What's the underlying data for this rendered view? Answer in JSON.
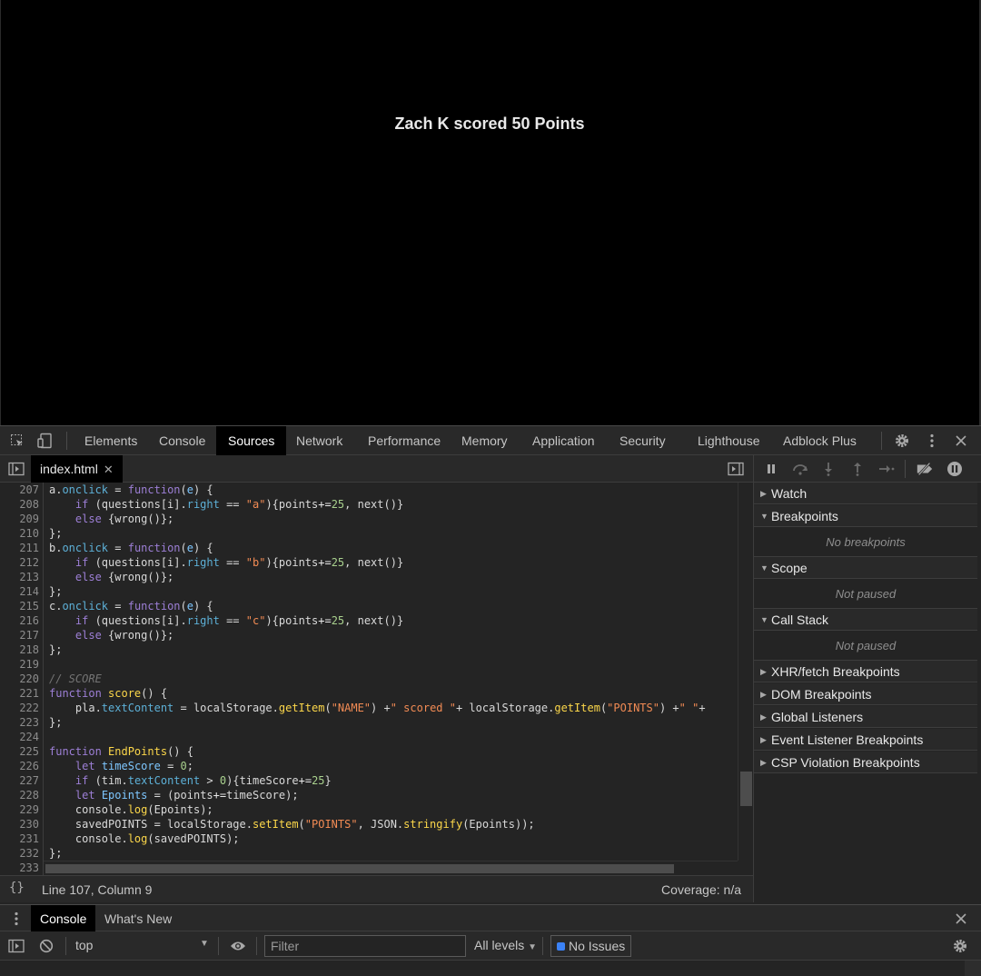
{
  "page": {
    "score_text": "Zach K scored 50 Points"
  },
  "devtools": {
    "tabs": [
      "Elements",
      "Console",
      "Sources",
      "Network",
      "Performance",
      "Memory",
      "Application",
      "Security",
      "Lighthouse",
      "Adblock Plus"
    ],
    "active_tab": "Sources",
    "toolbar_icons": [
      "inspect-icon",
      "device-toggle-icon",
      "settings-icon",
      "more-icon",
      "close-icon"
    ]
  },
  "sources": {
    "file_tab": "index.html",
    "code_lines": [
      {
        "n": "207",
        "segments": [
          [
            "",
            "a."
          ],
          [
            "prop",
            "onclick"
          ],
          [
            "",
            " = "
          ],
          [
            "kw",
            "function"
          ],
          [
            "",
            "("
          ],
          [
            "var",
            "e"
          ],
          [
            "",
            ") {"
          ]
        ]
      },
      {
        "n": "208",
        "segments": [
          [
            "",
            "    "
          ],
          [
            "kw",
            "if"
          ],
          [
            "",
            " (questions[i]."
          ],
          [
            "prop",
            "right"
          ],
          [
            "",
            " == "
          ],
          [
            "str",
            "\"a\""
          ],
          [
            "",
            "){points"
          ],
          [
            "op",
            "+="
          ],
          [
            "num",
            "25"
          ],
          [
            "",
            ", next()}"
          ]
        ]
      },
      {
        "n": "209",
        "segments": [
          [
            "",
            "    "
          ],
          [
            "kw",
            "else"
          ],
          [
            "",
            " {wrong()};"
          ]
        ]
      },
      {
        "n": "210",
        "segments": [
          [
            "",
            "};"
          ]
        ]
      },
      {
        "n": "211",
        "segments": [
          [
            "",
            "b."
          ],
          [
            "prop",
            "onclick"
          ],
          [
            "",
            " = "
          ],
          [
            "kw",
            "function"
          ],
          [
            "",
            "("
          ],
          [
            "var",
            "e"
          ],
          [
            "",
            ") {"
          ]
        ]
      },
      {
        "n": "212",
        "segments": [
          [
            "",
            "    "
          ],
          [
            "kw",
            "if"
          ],
          [
            "",
            " (questions[i]."
          ],
          [
            "prop",
            "right"
          ],
          [
            "",
            " == "
          ],
          [
            "str",
            "\"b\""
          ],
          [
            "",
            "){points"
          ],
          [
            "op",
            "+="
          ],
          [
            "num",
            "25"
          ],
          [
            "",
            ", next()}"
          ]
        ]
      },
      {
        "n": "213",
        "segments": [
          [
            "",
            "    "
          ],
          [
            "kw",
            "else"
          ],
          [
            "",
            " {wrong()};"
          ]
        ]
      },
      {
        "n": "214",
        "segments": [
          [
            "",
            "};"
          ]
        ]
      },
      {
        "n": "215",
        "segments": [
          [
            "",
            "c."
          ],
          [
            "prop",
            "onclick"
          ],
          [
            "",
            " = "
          ],
          [
            "kw",
            "function"
          ],
          [
            "",
            "("
          ],
          [
            "var",
            "e"
          ],
          [
            "",
            ") {"
          ]
        ]
      },
      {
        "n": "216",
        "segments": [
          [
            "",
            "    "
          ],
          [
            "kw",
            "if"
          ],
          [
            "",
            " (questions[i]."
          ],
          [
            "prop",
            "right"
          ],
          [
            "",
            " == "
          ],
          [
            "str",
            "\"c\""
          ],
          [
            "",
            "){points"
          ],
          [
            "op",
            "+="
          ],
          [
            "num",
            "25"
          ],
          [
            "",
            ", next()}"
          ]
        ]
      },
      {
        "n": "217",
        "segments": [
          [
            "",
            "    "
          ],
          [
            "kw",
            "else"
          ],
          [
            "",
            " {wrong()};"
          ]
        ]
      },
      {
        "n": "218",
        "segments": [
          [
            "",
            "};"
          ]
        ]
      },
      {
        "n": "219",
        "segments": [
          [
            "",
            ""
          ]
        ]
      },
      {
        "n": "220",
        "segments": [
          [
            "cm",
            "// SCORE"
          ]
        ]
      },
      {
        "n": "221",
        "segments": [
          [
            "kw",
            "function"
          ],
          [
            "",
            " "
          ],
          [
            "fn",
            "score"
          ],
          [
            "",
            "() {"
          ]
        ]
      },
      {
        "n": "222",
        "segments": [
          [
            "",
            "    pla."
          ],
          [
            "prop",
            "textContent"
          ],
          [
            "",
            " = localStorage."
          ],
          [
            "fn",
            "getItem"
          ],
          [
            "",
            "("
          ],
          [
            "str",
            "\"NAME\""
          ],
          [
            "",
            ") +"
          ],
          [
            "str",
            "\" scored \""
          ],
          [
            "",
            "+ localStorage."
          ],
          [
            "fn",
            "getItem"
          ],
          [
            "",
            "("
          ],
          [
            "str",
            "\"POINTS\""
          ],
          [
            "",
            ") +"
          ],
          [
            "str",
            "\" \""
          ],
          [
            "",
            "+"
          ]
        ]
      },
      {
        "n": "223",
        "segments": [
          [
            "",
            "};"
          ]
        ]
      },
      {
        "n": "224",
        "segments": [
          [
            "",
            ""
          ]
        ]
      },
      {
        "n": "225",
        "segments": [
          [
            "kw",
            "function"
          ],
          [
            "",
            " "
          ],
          [
            "fn",
            "EndPoints"
          ],
          [
            "",
            "() {"
          ]
        ]
      },
      {
        "n": "226",
        "segments": [
          [
            "",
            "    "
          ],
          [
            "kw",
            "let"
          ],
          [
            "",
            " "
          ],
          [
            "var",
            "timeScore"
          ],
          [
            "",
            " = "
          ],
          [
            "num",
            "0"
          ],
          [
            "",
            ";"
          ]
        ]
      },
      {
        "n": "227",
        "segments": [
          [
            "",
            "    "
          ],
          [
            "kw",
            "if"
          ],
          [
            "",
            " (tim."
          ],
          [
            "prop",
            "textContent"
          ],
          [
            "",
            " > "
          ],
          [
            "num",
            "0"
          ],
          [
            "",
            "){timeScore"
          ],
          [
            "op",
            "+="
          ],
          [
            "num",
            "25"
          ],
          [
            "",
            "}"
          ]
        ]
      },
      {
        "n": "228",
        "segments": [
          [
            "",
            "    "
          ],
          [
            "kw",
            "let"
          ],
          [
            "",
            " "
          ],
          [
            "var",
            "Epoints"
          ],
          [
            "",
            " = (points"
          ],
          [
            "op",
            "+="
          ],
          [
            "",
            "timeScore);"
          ]
        ]
      },
      {
        "n": "229",
        "segments": [
          [
            "",
            "    console."
          ],
          [
            "fn",
            "log"
          ],
          [
            "",
            "(Epoints);"
          ]
        ]
      },
      {
        "n": "230",
        "segments": [
          [
            "",
            "    savedPOINTS = localStorage."
          ],
          [
            "fn",
            "setItem"
          ],
          [
            "",
            "("
          ],
          [
            "str",
            "\"POINTS\""
          ],
          [
            "",
            ", JSON."
          ],
          [
            "fn",
            "stringify"
          ],
          [
            "",
            "(Epoints));"
          ]
        ]
      },
      {
        "n": "231",
        "segments": [
          [
            "",
            "    console."
          ],
          [
            "fn",
            "log"
          ],
          [
            "",
            "(savedPOINTS);"
          ]
        ]
      },
      {
        "n": "232",
        "segments": [
          [
            "",
            "};"
          ]
        ]
      },
      {
        "n": "233",
        "segments": [
          [
            "",
            ""
          ]
        ]
      }
    ],
    "pretty_print": "{}",
    "cursor_position": "Line 107, Column 9",
    "coverage": "Coverage: n/a"
  },
  "debugger": {
    "panes": [
      {
        "title": "Watch",
        "expanded": false
      },
      {
        "title": "Breakpoints",
        "expanded": true,
        "body": "No breakpoints"
      },
      {
        "title": "Scope",
        "expanded": true,
        "body": "Not paused"
      },
      {
        "title": "Call Stack",
        "expanded": true,
        "body": "Not paused"
      },
      {
        "title": "XHR/fetch Breakpoints",
        "expanded": false
      },
      {
        "title": "DOM Breakpoints",
        "expanded": false
      },
      {
        "title": "Global Listeners",
        "expanded": false
      },
      {
        "title": "Event Listener Breakpoints",
        "expanded": false
      },
      {
        "title": "CSP Violation Breakpoints",
        "expanded": false
      }
    ]
  },
  "drawer": {
    "tabs": [
      "Console",
      "What's New"
    ],
    "active_tab": "Console",
    "context": "top",
    "filter_placeholder": "Filter",
    "levels": "All levels",
    "issues": "No Issues"
  },
  "colors": {
    "issues_flag": "#3b82f6"
  }
}
